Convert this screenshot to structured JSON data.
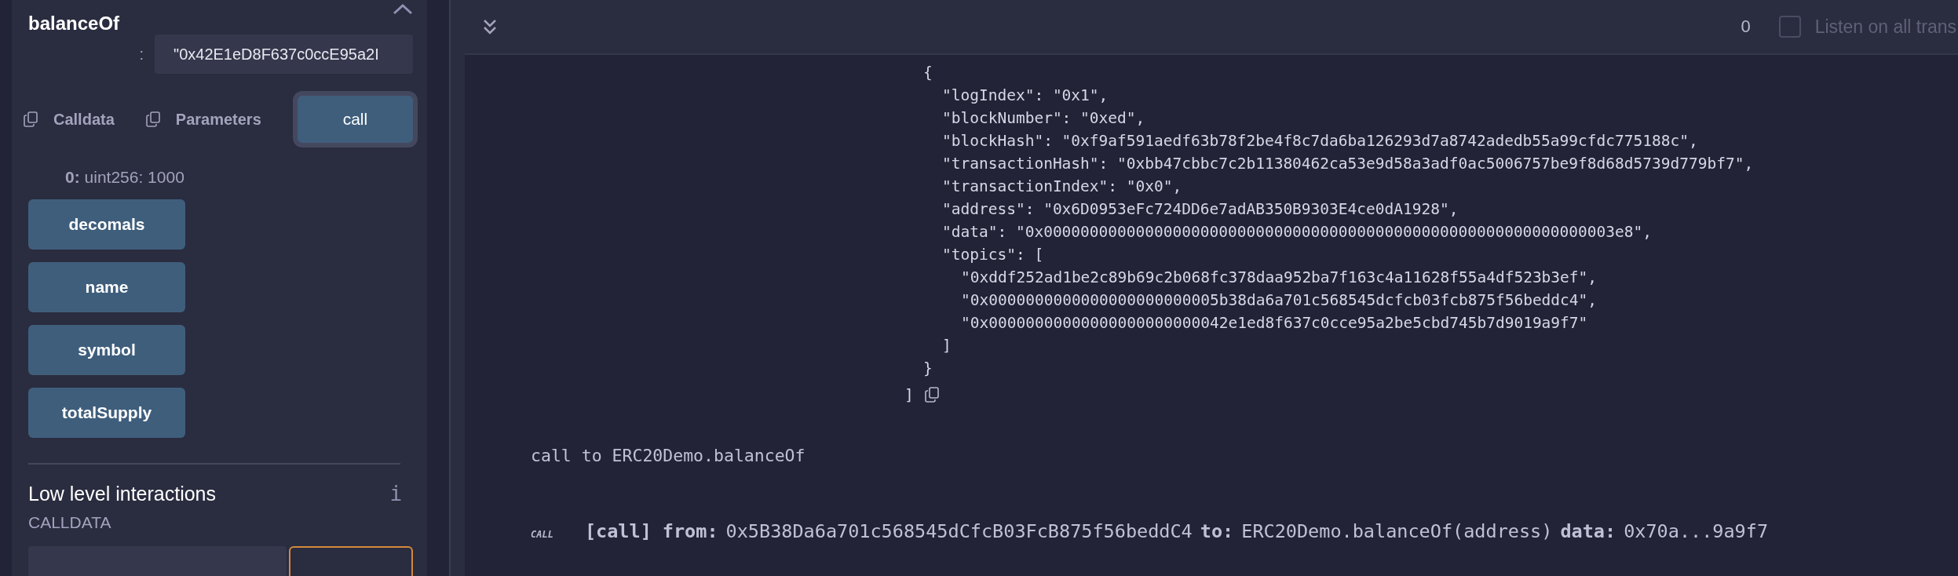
{
  "function_panel": {
    "title": "balanceOf",
    "collapse_expanded": true,
    "argument": {
      "separator": ":",
      "value": "\"0x42E1eD8F637c0ccE95a2I"
    },
    "actions": [
      {
        "kind": "copy",
        "label": "Calldata"
      },
      {
        "kind": "copy",
        "label": "Parameters"
      },
      {
        "kind": "primary",
        "label": "call"
      }
    ],
    "result": {
      "index": "0:",
      "value": "uint256: 1000"
    },
    "buttons": [
      "decomals",
      "name",
      "symbol",
      "totalSupply"
    ]
  },
  "low_level": {
    "title": "Low level interactions",
    "info": "i",
    "calldata_label": "CALLDATA"
  },
  "terminal": {
    "toolbar": {
      "count": "0",
      "listen_checked": false,
      "listen_label": "Listen on all trans"
    },
    "log": {
      "text": "{",
      "children": [
        {
          "text": "\"logIndex\": \"0x1\","
        },
        {
          "text": "\"blockNumber\": \"0xed\","
        },
        {
          "text": "\"blockHash\": \"0xf9af591aedf63b78f2be4f8c7da6ba126293d7a8742adedb55a99cfdc775188c\","
        },
        {
          "text": "\"transactionHash\": \"0xbb47cbbc7c2b11380462ca53e9d58a3adf0ac5006757be9f8d68d5739d779bf7\","
        },
        {
          "text": "\"transactionIndex\": \"0x0\","
        },
        {
          "text": "\"address\": \"0x6D0953eFc724DD6e7adAB350B9303E4ce0dA1928\","
        },
        {
          "text": "\"data\": \"0x00000000000000000000000000000000000000000000000000000000000003e8\","
        },
        {
          "text": "\"topics\": [",
          "children": [
            {
              "text": "\"0xddf252ad1be2c89b69c2b068fc378daa952ba7f163c4a11628f55a4df523b3ef\","
            },
            {
              "text": "\"0x0000000000000000000000005b38da6a701c568545dcfcb03fcb875f56beddc4\","
            },
            {
              "text": "\"0x00000000000000000000000042e1ed8f637c0cce95a2be5cbd745b7d9019a9f7\""
            }
          ],
          "close": "]"
        }
      ],
      "close": "}"
    },
    "log_end": "]",
    "message": "call to ERC20Demo.balanceOf",
    "call": {
      "tag": "CALL",
      "kind": "[call]",
      "fields": [
        {
          "label": "from:",
          "value": "0x5B38Da6a701c568545dCfcB03FcB875f56beddC4"
        },
        {
          "label": "to:",
          "value": "ERC20Demo.balanceOf(address)"
        },
        {
          "label": "data:",
          "value": "0x70a...9a9f7"
        }
      ]
    }
  }
}
